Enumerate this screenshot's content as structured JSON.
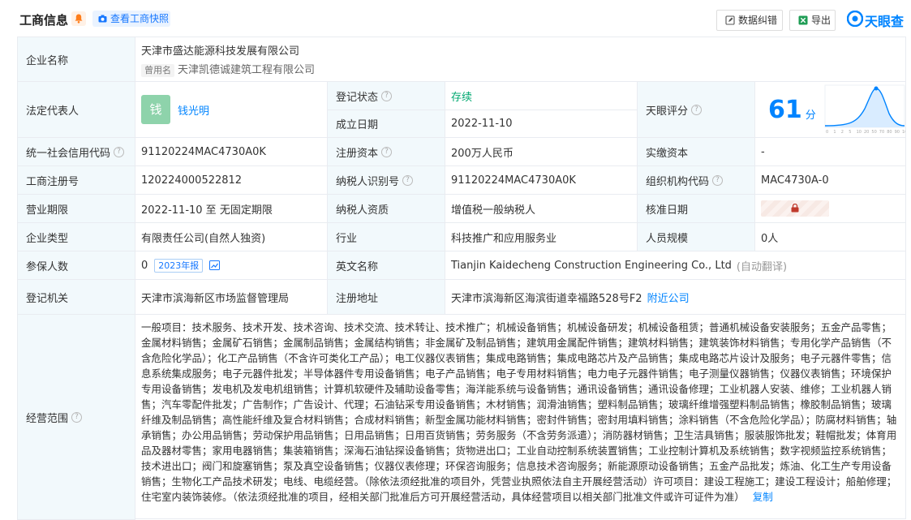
{
  "header": {
    "title": "工商信息",
    "snapshot_label": "查看工商快照",
    "data_fix_label": "数据纠错",
    "export_label": "导出",
    "logo_text": "天眼查"
  },
  "rows": {
    "company_name": {
      "label": "企业名称",
      "value": "天津市盛达能源科技发展有限公司",
      "former_tag": "曾用名",
      "former_value": "天津凯德诚建筑工程有限公司"
    },
    "legal_rep": {
      "label": "法定代表人",
      "avatar": "钱",
      "value": "钱光明"
    },
    "reg_status": {
      "label": "登记状态",
      "value": "存续"
    },
    "found_date": {
      "label": "成立日期",
      "value": "2022-11-10"
    },
    "score": {
      "label": "天眼评分",
      "value": "61",
      "unit": "分",
      "axis_ticks": [
        "0",
        "1",
        "2",
        "5",
        "10",
        "20",
        "50",
        "70",
        "80",
        "90",
        "100"
      ]
    },
    "credit_code": {
      "label": "统一社会信用代码",
      "value": "91120224MAC4730A0K"
    },
    "reg_capital": {
      "label": "注册资本",
      "value": "200万人民币"
    },
    "paid_capital": {
      "label": "实缴资本",
      "value": "-"
    },
    "reg_no": {
      "label": "工商注册号",
      "value": "120224000522812"
    },
    "taxpayer_id": {
      "label": "纳税人识别号",
      "value": "91120224MAC4730A0K"
    },
    "org_code": {
      "label": "组织机构代码",
      "value": "MAC4730A-0"
    },
    "term": {
      "label": "营业期限",
      "value": "2022-11-10 至 无固定期限"
    },
    "taxpayer_qual": {
      "label": "纳税人资质",
      "value": "增值税一般纳税人"
    },
    "approve_date": {
      "label": "核准日期"
    },
    "company_type": {
      "label": "企业类型",
      "value": "有限责任公司(自然人独资)"
    },
    "industry": {
      "label": "行业",
      "value": "科技推广和应用服务业"
    },
    "staff_size": {
      "label": "人员规模",
      "value": "0人"
    },
    "insured": {
      "label": "参保人数",
      "value": "0",
      "year_tag": "2023年报"
    },
    "en_name": {
      "label": "英文名称",
      "value": "Tianjin Kaidecheng Construction Engineering Co., Ltd",
      "note": "(自动翻译)"
    },
    "reg_authority": {
      "label": "登记机关",
      "value": "天津市滨海新区市场监督管理局"
    },
    "reg_address": {
      "label": "注册地址",
      "value": "天津市滨海新区海滨街道幸福路528号F2",
      "nearby": "附近公司"
    },
    "scope": {
      "label": "经营范围",
      "text": "一般项目：技术服务、技术开发、技术咨询、技术交流、技术转让、技术推广；机械设备销售；机械设备研发；机械设备租赁；普通机械设备安装服务；五金产品零售；金属材料销售；金属矿石销售；金属制品销售；金属结构销售；非金属矿及制品销售；建筑用金属配件销售；建筑材料销售；建筑装饰材料销售；专用化学产品销售（不含危险化学品）；化工产品销售（不含许可类化工产品）；电工仪器仪表销售；集成电路销售；集成电路芯片及产品销售；集成电路芯片设计及服务；电子元器件零售；信息系统集成服务；电子元器件批发；半导体器件专用设备销售；电子产品销售；电子专用材料销售；电力电子元器件销售；电子测量仪器销售；仪器仪表销售；环境保护专用设备销售；发电机及发电机组销售；计算机软硬件及辅助设备零售；海洋能系统与设备销售；通讯设备销售；通讯设备修理；工业机器人安装、维修；工业机器人销售；汽车零配件批发；广告制作；广告设计、代理；石油钻采专用设备销售；木材销售；润滑油销售；塑料制品销售；玻璃纤维增强塑料制品销售；橡胶制品销售；玻璃纤维及制品销售；高性能纤维及复合材料销售；合成材料销售；新型金属功能材料销售；密封件销售；密封用填料销售；涂料销售（不含危险化学品）；防腐材料销售；轴承销售；办公用品销售；劳动保护用品销售；日用品销售；日用百货销售；劳务服务（不含劳务派遣）；消防器材销售；卫生洁具销售；服装服饰批发；鞋帽批发；体育用品及器材零售；家用电器销售；集装箱销售；深海石油钻探设备销售；货物进出口；工业自动控制系统装置销售；工业控制计算机及系统销售；数字视频监控系统销售；技术进出口；阀门和旋塞销售；泵及真空设备销售；仪器仪表修理；环保咨询服务；信息技术咨询服务；新能源原动设备销售；五金产品批发；炼油、化工生产专用设备销售；生物化工产品技术研发；电线、电缆经营。（除依法须经批准的项目外，凭营业执照依法自主开展经营活动）许可项目：建设工程施工；建设工程设计；船舶修理；住宅室内装饰装修。（依法须经批准的项目，经相关部门批准后方可开展经营活动，具体经营项目以相关部门批准文件或许可证件为准）",
      "copy_label": "复制"
    }
  },
  "colors": {
    "accent": "#0084ff",
    "label_bg": "#f2f9fc",
    "status_green": "#00a870",
    "avatar_green": "#8ed3ab"
  },
  "icons": [
    "bell-icon",
    "camera-icon",
    "edit-icon",
    "excel-icon",
    "tianyancha-logo",
    "question-icon",
    "trend-chart-icon",
    "lock-icon"
  ]
}
